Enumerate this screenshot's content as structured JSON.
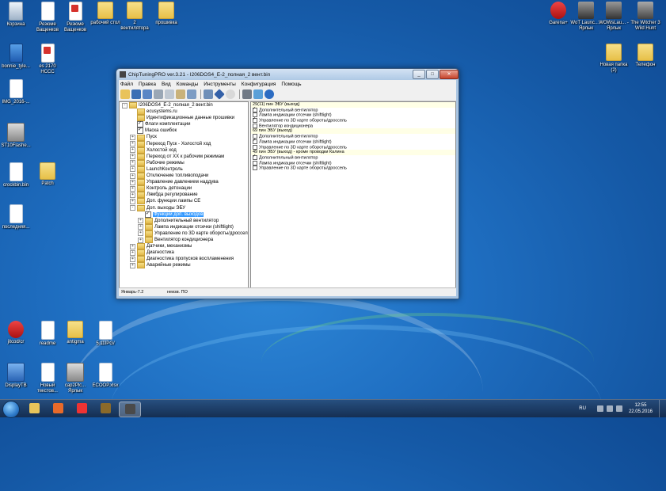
{
  "desktop_icons": [
    {
      "label": "Корзина",
      "kind": "recycle"
    },
    {
      "label": "Резюме Ващенков",
      "kind": "doc"
    },
    {
      "label": "Резюме Ващенков",
      "kind": "pdf"
    },
    {
      "label": "рабочий стол",
      "kind": "folder"
    },
    {
      "label": "2 вентилятора",
      "kind": "folder"
    },
    {
      "label": "прошивка",
      "kind": "folder"
    },
    {
      "label": "bonnie_tyle...",
      "kind": "mp3"
    },
    {
      "label": "es 2170 НССС",
      "kind": "pdf"
    },
    {
      "label": "IMG_2016-...",
      "kind": "doc"
    },
    {
      "label": "ST10Flashe...",
      "kind": "app"
    },
    {
      "label": "crockbin.bin",
      "kind": "doc"
    },
    {
      "label": "Patch",
      "kind": "folder"
    },
    {
      "label": "последняя...",
      "kind": "doc"
    },
    {
      "label": "Garena+",
      "kind": "red"
    },
    {
      "label": "WoT Launc... - Ярлык",
      "kind": "tank"
    },
    {
      "label": "WOWsLau... - Ярлык",
      "kind": "tank"
    },
    {
      "label": "The Witcher 3 Wild Hunt",
      "kind": "wolf"
    },
    {
      "label": "Новая папка (2)",
      "kind": "folder"
    },
    {
      "label": "Телефон",
      "kind": "folder"
    },
    {
      "label": "jitcod/cr",
      "kind": "red"
    },
    {
      "label": "readme",
      "kind": "doc"
    },
    {
      "label": "antigma",
      "kind": "folder"
    },
    {
      "label": "5.11IPG/",
      "kind": "doc"
    },
    {
      "label": "DisplayTB",
      "kind": "blue"
    },
    {
      "label": "Новый текстов...",
      "kind": "doc"
    },
    {
      "label": "cap2Plc... Ярлык",
      "kind": "app"
    },
    {
      "label": "ECOOP.xlsx",
      "kind": "doc"
    }
  ],
  "window": {
    "title": "ChipTuningPRO ver.3.21 - I206DOS4_E-2_полная_2 вент.bin",
    "min": "_",
    "max": "□",
    "close": "✕",
    "menu": [
      "Файл",
      "Правка",
      "Вид",
      "Команды",
      "Инструменты",
      "Конфигурация",
      "Помощь"
    ],
    "status": [
      "Январь-7.2",
      "неизв. ПО"
    ]
  },
  "tree": [
    {
      "label": "I206DOS4_E-2_полная_2 вент.bin",
      "depth": 0,
      "ex": "-",
      "type": "folder"
    },
    {
      "label": "ecusystems.ru",
      "depth": 1,
      "ex": "",
      "type": "folder"
    },
    {
      "label": "Идентификационные данные прошивки",
      "depth": 1,
      "ex": "",
      "type": "folder"
    },
    {
      "label": "Флаги комплектации",
      "depth": 1,
      "ex": "",
      "type": "check"
    },
    {
      "label": "Маска ошибок",
      "depth": 1,
      "ex": "",
      "type": "check"
    },
    {
      "label": "Пуск",
      "depth": 1,
      "ex": "+",
      "type": "folder"
    },
    {
      "label": "Переход Пуск - Холостой ход",
      "depth": 1,
      "ex": "+",
      "type": "folder"
    },
    {
      "label": "Холостой ход",
      "depth": 1,
      "ex": "+",
      "type": "folder"
    },
    {
      "label": "Переход от ХХ к рабочим режимам",
      "depth": 1,
      "ex": "+",
      "type": "folder"
    },
    {
      "label": "Рабочие режимы",
      "depth": 1,
      "ex": "+",
      "type": "folder"
    },
    {
      "label": "LaunchКонтроль",
      "depth": 1,
      "ex": "+",
      "type": "folder"
    },
    {
      "label": "Отключение топливоподачи",
      "depth": 1,
      "ex": "+",
      "type": "folder"
    },
    {
      "label": "Управление давлением наддува",
      "depth": 1,
      "ex": "+",
      "type": "folder"
    },
    {
      "label": "Контроль детонации",
      "depth": 1,
      "ex": "+",
      "type": "folder"
    },
    {
      "label": "Лямбда регулирование",
      "depth": 1,
      "ex": "+",
      "type": "folder"
    },
    {
      "label": "Доп. функции лампы CE",
      "depth": 1,
      "ex": "+",
      "type": "folder"
    },
    {
      "label": "Доп. выходы ЭБУ",
      "depth": 1,
      "ex": "-",
      "type": "folder"
    },
    {
      "label": "Функции доп. выходов",
      "depth": 2,
      "ex": "",
      "type": "check",
      "selected": true
    },
    {
      "label": "Дополнительный вентилятор",
      "depth": 2,
      "ex": "+",
      "type": "folder"
    },
    {
      "label": "Лампа индикации отсечки (shiftlight)",
      "depth": 2,
      "ex": "+",
      "type": "folder"
    },
    {
      "label": "Управление по 3D карте обороты/дроссель",
      "depth": 2,
      "ex": "+",
      "type": "folder"
    },
    {
      "label": "Вентилятор кондиционера",
      "depth": 2,
      "ex": "+",
      "type": "folder"
    },
    {
      "label": "Датчики, механизмы",
      "depth": 1,
      "ex": "+",
      "type": "folder"
    },
    {
      "label": "Диагностика",
      "depth": 1,
      "ex": "+",
      "type": "folder"
    },
    {
      "label": "Диагностика пропусков воспламенения",
      "depth": 1,
      "ex": "+",
      "type": "folder"
    },
    {
      "label": "Аварийные режимы",
      "depth": 1,
      "ex": "+",
      "type": "folder"
    }
  ],
  "options": [
    {
      "label": "29(11) пин ЭБУ (выход)",
      "hdr": true
    },
    {
      "label": "Дополнительный вентилятор",
      "checked": true
    },
    {
      "label": "Лампа индикации отсечки (shiftlight)",
      "checked": false
    },
    {
      "label": "Управление по 3D карте обороты/дроссель",
      "checked": true
    },
    {
      "label": "Вентилятор кондиционера",
      "checked": false
    },
    {
      "label": "69 пин ЭБУ (выход)",
      "hdr": true
    },
    {
      "label": "Дополнительный вентилятор",
      "checked": false
    },
    {
      "label": "Лампа индикации отсечки (shiftlight)",
      "checked": true
    },
    {
      "label": "Управление по 3D карте обороты/дроссель",
      "checked": false
    },
    {
      "label": "49 пин ЭБУ (выход) - кроме проводки Калина",
      "hdr": true
    },
    {
      "label": "Дополнительный вентилятор",
      "checked": true
    },
    {
      "label": "Лампа индикации отсечки (shiftlight)",
      "checked": false
    },
    {
      "label": "Управление по 3D карте обороты/дроссель",
      "checked": false
    }
  ],
  "taskbar": {
    "language": "RU",
    "time": "12:55",
    "date": "22.05.2016",
    "apps": [
      {
        "name": "explorer-icon",
        "active": false
      },
      {
        "name": "firefox-icon",
        "active": false
      },
      {
        "name": "yandex-icon",
        "active": false
      },
      {
        "name": "battle-icon",
        "active": false
      },
      {
        "name": "chiptuning-icon",
        "active": true
      }
    ]
  }
}
